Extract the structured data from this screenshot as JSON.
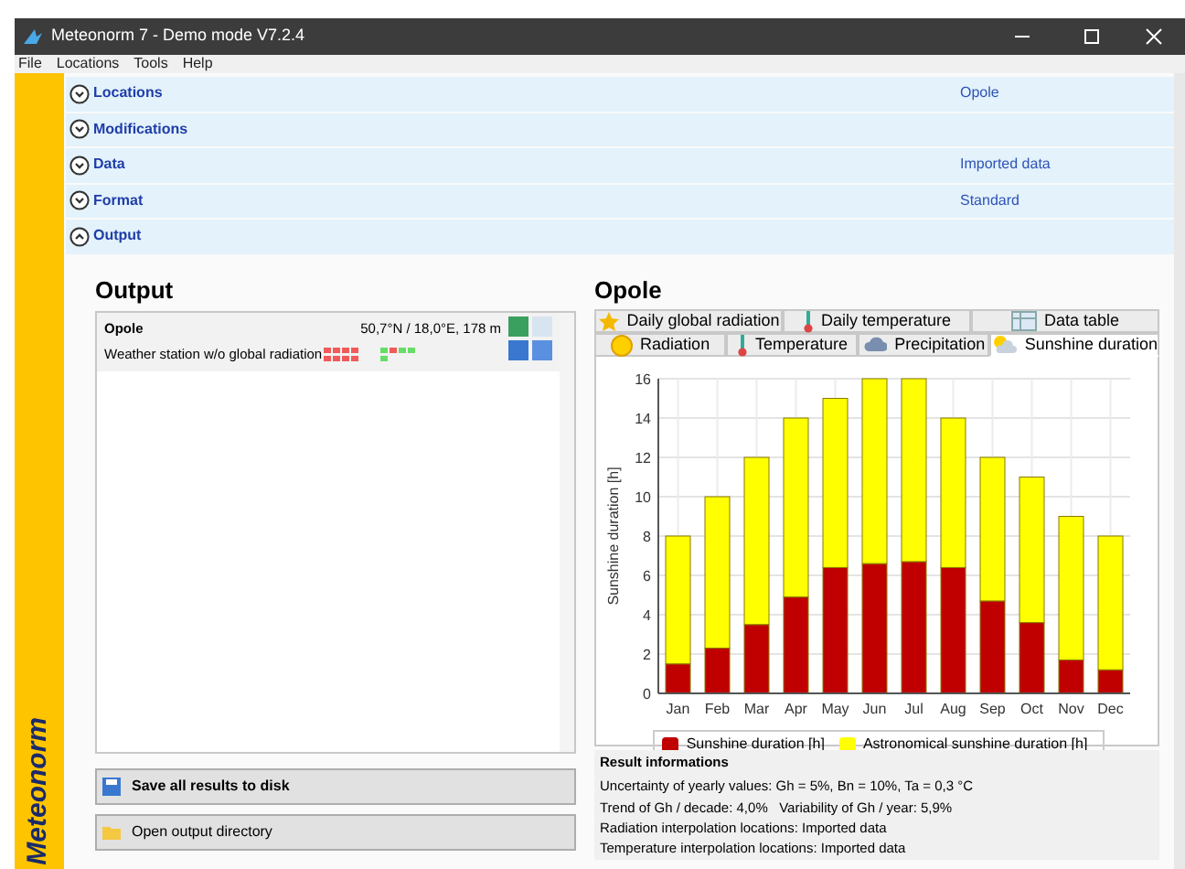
{
  "window": {
    "title": "Meteonorm 7 - Demo mode V7.2.4"
  },
  "menu": [
    "File",
    "Locations",
    "Tools",
    "Help"
  ],
  "sidebar": {
    "brand": "Meteonorm"
  },
  "sections": [
    {
      "label": "Locations",
      "value": "Opole",
      "expanded": false
    },
    {
      "label": "Modifications",
      "expanded": false
    },
    {
      "label": "Data",
      "value": "Imported data",
      "expanded": false
    },
    {
      "label": "Format",
      "value": "Standard",
      "expanded": false
    },
    {
      "label": "Output",
      "expanded": true
    }
  ],
  "output": {
    "title": "Output",
    "stations": [
      {
        "name": "Opole",
        "coords": "50,7°N / 18,0°E, 178 m",
        "type": "Weather station w/o global radiation"
      }
    ],
    "buttons": [
      {
        "label": "Save all results to disk",
        "kind": "save"
      },
      {
        "label": "Open output directory",
        "kind": "folder"
      }
    ]
  },
  "result": {
    "title": "Opole",
    "tabs_top": [
      {
        "label": "Daily global radiation",
        "selected": false,
        "kind": "star"
      },
      {
        "label": "Daily temperature",
        "selected": false,
        "kind": "thermo"
      },
      {
        "label": "Data table",
        "selected": false,
        "kind": "table"
      }
    ],
    "tabs_bottom": [
      {
        "label": "Radiation",
        "selected": false,
        "kind": "sun"
      },
      {
        "label": "Temperature",
        "selected": false,
        "kind": "thermo"
      },
      {
        "label": "Precipitation",
        "selected": false,
        "kind": "rain"
      },
      {
        "label": "Sunshine duration",
        "selected": true,
        "kind": "cloud"
      }
    ],
    "chart_data": {
      "type": "bar",
      "ylabel": "Sunshine duration [h]",
      "categories": [
        "Jan",
        "Feb",
        "Mar",
        "Apr",
        "May",
        "Jun",
        "Jul",
        "Aug",
        "Sep",
        "Oct",
        "Nov",
        "Dec"
      ],
      "series": [
        {
          "name": "Sunshine duration [h]",
          "color": "#c00000",
          "values": [
            1.5,
            2.3,
            3.5,
            4.9,
            6.4,
            6.6,
            6.7,
            6.4,
            4.7,
            3.6,
            1.7,
            1.2
          ]
        },
        {
          "name": "Astronomical sunshine duration [h]",
          "color": "#ffff00",
          "values": [
            6.5,
            7.7,
            8.5,
            9.1,
            8.6,
            9.4,
            9.3,
            7.6,
            7.3,
            7.4,
            7.3,
            6.8
          ]
        }
      ],
      "ylim": [
        0,
        16
      ],
      "yticks": [
        0,
        2,
        4,
        6,
        8,
        10,
        12,
        14,
        16
      ],
      "stacked": true,
      "grid": true,
      "legend": "bottom"
    },
    "info": {
      "title": "Result informations",
      "lines": [
        "Uncertainty of yearly values: Gh = 5%, Bn = 10%, Ta = 0,3 °C",
        "Trend of Gh / decade: 4,0%   Variability of Gh / year: 5,9%",
        "Radiation interpolation locations: Imported data",
        "Temperature interpolation locations: Imported data"
      ]
    }
  }
}
